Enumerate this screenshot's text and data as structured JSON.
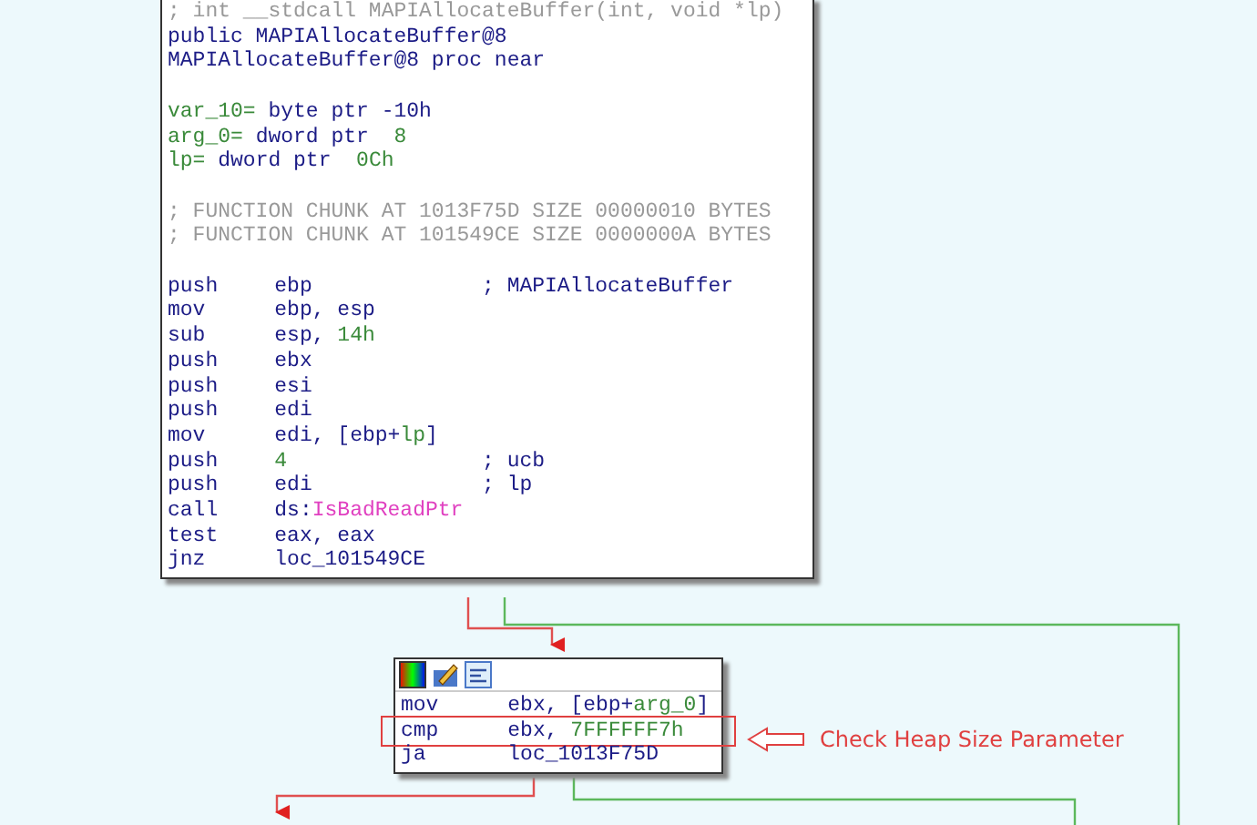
{
  "nodes": [
    {
      "toolbar": false,
      "lines": [
        {
          "kind": "comment",
          "text": "; int __stdcall MAPIAllocateBuffer(int, void *lp)"
        },
        {
          "kind": "decl",
          "parts": [
            {
              "kind": "keyword",
              "text": "public MAPIAllocateBuffer@8"
            }
          ]
        },
        {
          "kind": "decl",
          "parts": [
            {
              "kind": "keyword",
              "text": "MAPIAllocateBuffer@8 proc near"
            }
          ]
        },
        {
          "kind": "blank"
        },
        {
          "kind": "decl",
          "parts": [
            {
              "kind": "name",
              "text": "var_10="
            },
            {
              "kind": "keyword",
              "text": " byte ptr -10h"
            }
          ]
        },
        {
          "kind": "decl",
          "parts": [
            {
              "kind": "name",
              "text": "arg_0="
            },
            {
              "kind": "keyword",
              "text": " dword ptr  "
            },
            {
              "kind": "number",
              "text": "8"
            }
          ]
        },
        {
          "kind": "decl",
          "parts": [
            {
              "kind": "name",
              "text": "lp="
            },
            {
              "kind": "keyword",
              "text": " dword ptr  "
            },
            {
              "kind": "number",
              "text": "0Ch"
            }
          ]
        },
        {
          "kind": "blank"
        },
        {
          "kind": "comment",
          "text": "; FUNCTION CHUNK AT 1013F75D SIZE 00000010 BYTES"
        },
        {
          "kind": "comment",
          "text": "; FUNCTION CHUNK AT 101549CE SIZE 0000000A BYTES"
        },
        {
          "kind": "blank"
        },
        {
          "kind": "instr",
          "mnemonic": "push",
          "operands": [
            {
              "kind": "keyword",
              "text": "ebp"
            }
          ],
          "comment": "; MAPIAllocateBuffer"
        },
        {
          "kind": "instr",
          "mnemonic": "mov",
          "operands": [
            {
              "kind": "keyword",
              "text": "ebp, esp"
            }
          ]
        },
        {
          "kind": "instr",
          "mnemonic": "sub",
          "operands": [
            {
              "kind": "keyword",
              "text": "esp, "
            },
            {
              "kind": "number",
              "text": "14h"
            }
          ]
        },
        {
          "kind": "instr",
          "mnemonic": "push",
          "operands": [
            {
              "kind": "keyword",
              "text": "ebx"
            }
          ]
        },
        {
          "kind": "instr",
          "mnemonic": "push",
          "operands": [
            {
              "kind": "keyword",
              "text": "esi"
            }
          ]
        },
        {
          "kind": "instr",
          "mnemonic": "push",
          "operands": [
            {
              "kind": "keyword",
              "text": "edi"
            }
          ]
        },
        {
          "kind": "instr",
          "mnemonic": "mov",
          "operands": [
            {
              "kind": "keyword",
              "text": "edi, [ebp+"
            },
            {
              "kind": "name",
              "text": "lp"
            },
            {
              "kind": "keyword",
              "text": "]"
            }
          ]
        },
        {
          "kind": "instr",
          "mnemonic": "push",
          "operands": [
            {
              "kind": "number",
              "text": "4"
            }
          ],
          "comment": "; ucb"
        },
        {
          "kind": "instr",
          "mnemonic": "push",
          "operands": [
            {
              "kind": "keyword",
              "text": "edi"
            }
          ],
          "comment": "; lp"
        },
        {
          "kind": "instr",
          "mnemonic": "call",
          "operands": [
            {
              "kind": "keyword",
              "text": "ds:"
            },
            {
              "kind": "import",
              "text": "IsBadReadPtr"
            }
          ]
        },
        {
          "kind": "instr",
          "mnemonic": "test",
          "operands": [
            {
              "kind": "keyword",
              "text": "eax, eax"
            }
          ]
        },
        {
          "kind": "instr",
          "mnemonic": "jnz",
          "operands": [
            {
              "kind": "keyword",
              "text": "loc_101549CE"
            }
          ]
        }
      ]
    },
    {
      "toolbar": true,
      "lines": [
        {
          "kind": "instr",
          "mnemonic": "mov",
          "operands": [
            {
              "kind": "keyword",
              "text": "ebx, [ebp+"
            },
            {
              "kind": "name",
              "text": "arg_0"
            },
            {
              "kind": "keyword",
              "text": "]"
            }
          ]
        },
        {
          "kind": "instr",
          "mnemonic": "cmp",
          "operands": [
            {
              "kind": "keyword",
              "text": "ebx, "
            },
            {
              "kind": "number",
              "text": "7FFFFFF7h"
            }
          ],
          "highlighted": true
        },
        {
          "kind": "instr",
          "mnemonic": "ja",
          "operands": [
            {
              "kind": "keyword",
              "text": "loc_1013F75D"
            }
          ]
        }
      ]
    }
  ],
  "annotation": {
    "label": "Check Heap Size Parameter"
  }
}
